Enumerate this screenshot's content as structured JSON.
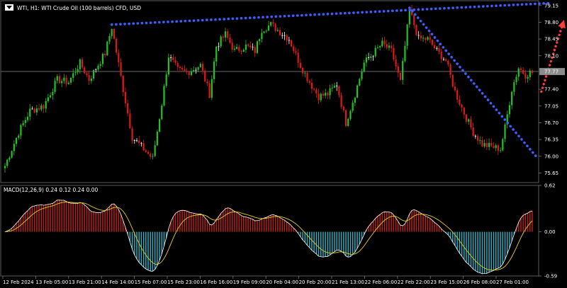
{
  "chart_title": "WTI, H1:  WTI Crude Oil (100 barrels) CFD, USD",
  "macd_label": "MACD(12,26,9) 0.24 0.12 0.24 0.00",
  "current_price_label": "77.77",
  "colors": {
    "background": "#000000",
    "bull_candle": "#22c322",
    "bear_candle": "#e01818",
    "doji_candle": "#ffffff",
    "trendline": "#3d5eff",
    "arrow": "#ff3b3b",
    "macd_positive": "#c0201c",
    "macd_negative": "#2fb3c6",
    "macd_line": "#ffffff",
    "signal_line": "#e8d020",
    "price_line": "#9a9a9a"
  },
  "chart_data": [
    {
      "type": "candlestick",
      "title": "WTI, H1:  WTI Crude Oil (100 barrels) CFD, USD",
      "ylim": [
        75.45,
        79.25
      ],
      "y_ticks": [
        "79.15",
        "78.80",
        "78.45",
        "78.10",
        "77.77",
        "77.40",
        "77.05",
        "76.70",
        "76.35",
        "76.00",
        "75.65"
      ],
      "x_ticks": [
        "12 Feb 2024",
        "13 Feb 05:00",
        "13 Feb 21:00",
        "14 Feb 14:00",
        "15 Feb 07:00",
        "15 Feb 23:00",
        "16 Feb 16:00",
        "19 Feb 09:00",
        "20 Feb 04:00",
        "20 Feb 20:00",
        "21 Feb 13:00",
        "22 Feb 06:00",
        "22 Feb 22:00",
        "23 Feb 15:00",
        "26 Feb 08:00",
        "27 Feb 01:00"
      ],
      "current_price": 77.77,
      "anchors": [
        [
          0,
          75.8
        ],
        [
          6,
          76.5
        ],
        [
          11,
          76.95
        ],
        [
          17,
          77.05
        ],
        [
          23,
          77.6
        ],
        [
          28,
          77.55
        ],
        [
          33,
          77.95
        ],
        [
          37,
          77.6
        ],
        [
          44,
          78.15
        ],
        [
          47,
          78.7
        ],
        [
          52,
          77.4
        ],
        [
          56,
          76.4
        ],
        [
          60,
          76.2
        ],
        [
          65,
          75.95
        ],
        [
          69,
          77.1
        ],
        [
          72,
          78.1
        ],
        [
          76,
          77.8
        ],
        [
          80,
          77.75
        ],
        [
          86,
          77.9
        ],
        [
          90,
          77.3
        ],
        [
          93,
          78.3
        ],
        [
          97,
          78.55
        ],
        [
          101,
          78.2
        ],
        [
          106,
          78.3
        ],
        [
          110,
          78.2
        ],
        [
          113,
          78.65
        ],
        [
          117,
          78.75
        ],
        [
          121,
          78.6
        ],
        [
          125,
          78.45
        ],
        [
          130,
          77.9
        ],
        [
          134,
          77.55
        ],
        [
          138,
          77.25
        ],
        [
          142,
          77.3
        ],
        [
          146,
          77.5
        ],
        [
          150,
          76.7
        ],
        [
          154,
          77.3
        ],
        [
          158,
          77.95
        ],
        [
          162,
          78.15
        ],
        [
          166,
          78.35
        ],
        [
          170,
          78.2
        ],
        [
          174,
          77.55
        ],
        [
          178,
          79.05
        ],
        [
          182,
          78.45
        ],
        [
          186,
          78.45
        ],
        [
          190,
          78.2
        ],
        [
          194,
          78.0
        ],
        [
          198,
          77.35
        ],
        [
          202,
          76.9
        ],
        [
          206,
          76.5
        ],
        [
          210,
          76.25
        ],
        [
          214,
          76.2
        ],
        [
          218,
          76.15
        ],
        [
          220,
          76.6
        ],
        [
          223,
          77.4
        ],
        [
          226,
          77.85
        ],
        [
          229,
          77.7
        ],
        [
          231,
          77.75
        ]
      ],
      "trendlines": [
        {
          "from": [
            47,
            78.75
          ],
          "to": [
            240,
            79.2
          ]
        },
        {
          "from": [
            178,
            79.1
          ],
          "to": [
            234,
            75.98
          ]
        }
      ],
      "arrow": {
        "from": [
          236,
          77.35
        ],
        "to": [
          246,
          78.85
        ]
      }
    },
    {
      "type": "macd",
      "title": "MACD(12,26,9) 0.24 0.12 0.24 0.00",
      "ylim": [
        -0.59,
        0.62
      ],
      "y_ticks": [
        "0.62",
        "0.00",
        "-0.59"
      ],
      "macd": 0.24,
      "signal": 0.12
    }
  ]
}
